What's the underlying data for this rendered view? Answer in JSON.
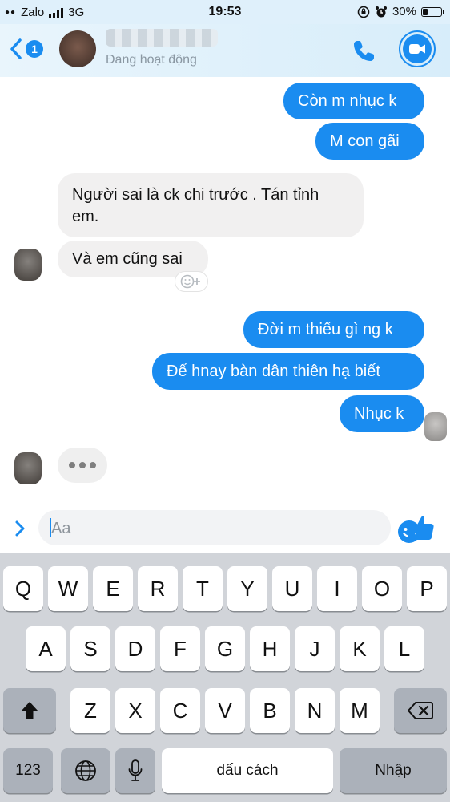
{
  "status_bar": {
    "carrier": "Zalo",
    "network": "3G",
    "time": "19:53",
    "battery_percent": "30%",
    "battery_level": 0.3
  },
  "header": {
    "unread_count": "1",
    "contact_status": "Đang hoạt động",
    "accent_color": "#1a8cf0"
  },
  "messages": [
    {
      "direction": "out",
      "text": "Còn m nhục k"
    },
    {
      "direction": "out",
      "text": "M con gãi"
    },
    {
      "direction": "in",
      "text": "Người sai là ck chi trước . Tán tỉnh em."
    },
    {
      "direction": "in",
      "text": "Và em cũng sai"
    },
    {
      "direction": "out",
      "text": "Đời m thiếu gì ng k"
    },
    {
      "direction": "out",
      "text": "Để hnay bàn dân thiên hạ biết"
    },
    {
      "direction": "out",
      "text": "Nhục k"
    }
  ],
  "composer": {
    "placeholder": "Aa"
  },
  "keyboard": {
    "row1": [
      "Q",
      "W",
      "E",
      "R",
      "T",
      "Y",
      "U",
      "I",
      "O",
      "P"
    ],
    "row2": [
      "A",
      "S",
      "D",
      "F",
      "G",
      "H",
      "J",
      "K",
      "L"
    ],
    "row3": [
      "Z",
      "X",
      "C",
      "V",
      "B",
      "N",
      "M"
    ],
    "numbers_label": "123",
    "space_label": "dấu cách",
    "return_label": "Nhập"
  },
  "icons": [
    "back-chevron-icon",
    "phone-icon",
    "video-camera-icon",
    "react-emoji-icon",
    "expand-chevron-icon",
    "emoji-icon",
    "thumbs-up-icon",
    "shift-icon",
    "delete-icon",
    "globe-icon",
    "microphone-icon"
  ]
}
